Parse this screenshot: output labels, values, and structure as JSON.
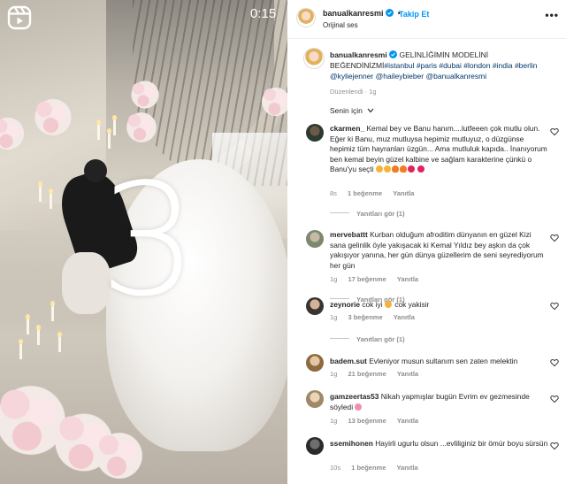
{
  "video": {
    "countdown": "3",
    "timer": "0:15",
    "reel_icon": "reels-icon"
  },
  "post": {
    "author": "banualkanresmi",
    "follow_label": "Takip Et",
    "separator": "•",
    "audio": "Orijinal ses",
    "caption_text": "GELİNLİĞİMİN MODELİNİ BEĞENDİNİZMİ",
    "caption_tags": [
      "#istanbul",
      "#paris",
      "#dubai",
      "#london",
      "#india",
      "#berlin",
      "@kyliejenner",
      "@haileybieber",
      "@banualkanresmi"
    ],
    "edited": "Düzenlendi · 1g",
    "sort_label": "Senin için",
    "sort_icon": "chevron-down-icon"
  },
  "comments": [
    {
      "user": "ckarmen_",
      "text": "Kemal bey ve Banu hanım....lutfeeen çok mutlu olun. Eğer ki Banu, muz mutluysa hepimiz mutluyuz, o düzgünse hepimiz tüm hayranları üzgün... Ama mutluluk kapıda.. İnanıyorum ben kemal beyin güzel kalbine ve sağlam karakterine çünkü o Banu'yu seçti",
      "time": "8s",
      "likes": "1 beğenme",
      "reply": "Yanıtla",
      "view_replies": "Yanıtları gör (1)"
    },
    {
      "user": "mervebattt",
      "text": "Kurban olduğum afroditim dünyanın en güzel Kizi sana gelinlik öyle yakışacak ki Kemal Yıldız bey aşkın da çok yakışıyor yanına, her gün dünya güzellerim de seni seyrediyorum her gün",
      "time": "1g",
      "likes": "17 beğenme",
      "reply": "Yanıtla",
      "view_replies": "Yanıtları gör (1)"
    },
    {
      "user": "zeynorie",
      "text": "cok iyi",
      "text_after": "cok yakisir",
      "time": "1g",
      "likes": "3 beğenme",
      "reply": "Yanıtla",
      "view_replies": "Yanıtları gör (1)"
    },
    {
      "user": "badem.sut",
      "text": "Evleniyor musun sultanım sen zaten melektin",
      "time": "1g",
      "likes": "21 beğenme",
      "reply": "Yanıtla"
    },
    {
      "user": "gamzeertas53",
      "text": "Nikah yapmışlar bugün Evrim ev gezmesinde söyledi",
      "time": "1g",
      "likes": "13 beğenme",
      "reply": "Yanıtla"
    },
    {
      "user": "ssemihonen",
      "text": "Hayirli ugurlu olsun ...evliliginiz bir ömür boyu sürsün",
      "time": "10s",
      "likes": "1 beğenme",
      "reply": "Yanıtla"
    }
  ],
  "colors": {
    "link": "#00376b",
    "follow": "#0095f6",
    "verified": "#0095f6",
    "muted": "#8e8e8e"
  }
}
